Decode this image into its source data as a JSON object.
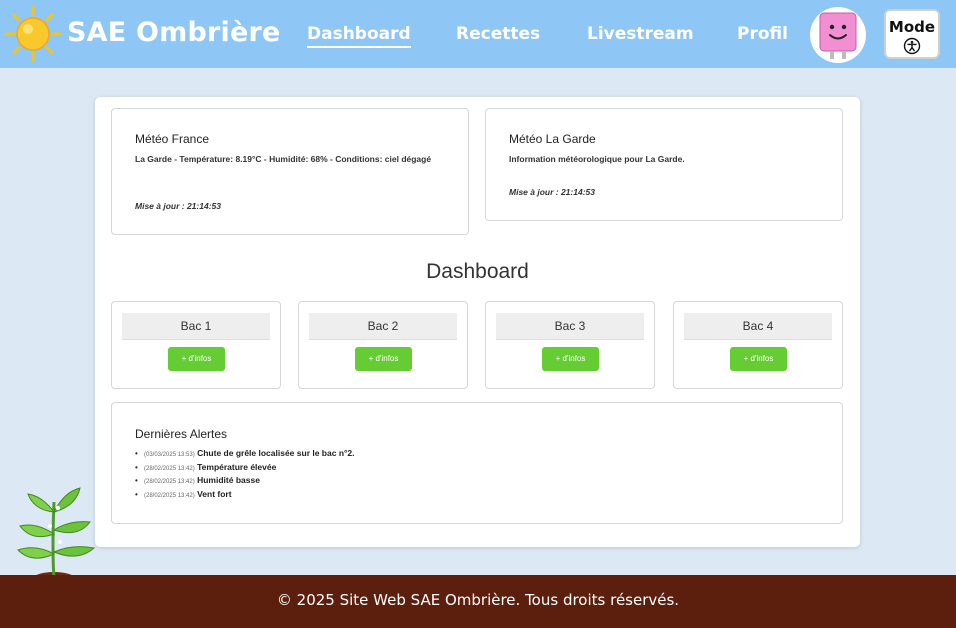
{
  "header": {
    "site_title": "SAE Ombrière",
    "nav": [
      {
        "label": "Dashboard"
      },
      {
        "label": "Recettes"
      },
      {
        "label": "Livestream"
      },
      {
        "label": "Profil"
      }
    ],
    "mode_label": "Mode",
    "logo_icon": "sun-icon",
    "mode_icon": "accessibility-icon"
  },
  "weather": {
    "france": {
      "title": "Météo France",
      "text": "La Garde - Température: 8.19°C - Humidité: 68% - Conditions: ciel dégagé",
      "updated": "Mise à jour : 21:14:53"
    },
    "lagarde": {
      "title": "Météo La Garde",
      "text": "Information météorologique pour La Garde.",
      "updated": "Mise à jour : 21:14:53"
    }
  },
  "dashboard": {
    "title": "Dashboard",
    "bacs": [
      {
        "name": "Bac 1",
        "button": "+ d'infos"
      },
      {
        "name": "Bac 2",
        "button": "+ d'infos"
      },
      {
        "name": "Bac 3",
        "button": "+ d'infos"
      },
      {
        "name": "Bac 4",
        "button": "+ d'infos"
      }
    ]
  },
  "alerts": {
    "title": "Dernières Alertes",
    "items": [
      {
        "time": "(03/03/2025 13:53)",
        "message": "Chute de grêle localisée sur le bac n°2."
      },
      {
        "time": "(28/02/2025 13:42)",
        "message": "Température élevée"
      },
      {
        "time": "(28/02/2025 13:42)",
        "message": "Humidité basse"
      },
      {
        "time": "(28/02/2025 13:42)",
        "message": "Vent fort"
      }
    ]
  },
  "footer": {
    "text": "© 2025 Site Web SAE Ombrière. Tous droits réservés."
  },
  "colors": {
    "header_bg": "#8ec6f5",
    "page_bg": "#dce8f3",
    "button_green": "#66cc33",
    "footer_bg": "#5c1f0d",
    "avatar_pink": "#f28fd3"
  }
}
